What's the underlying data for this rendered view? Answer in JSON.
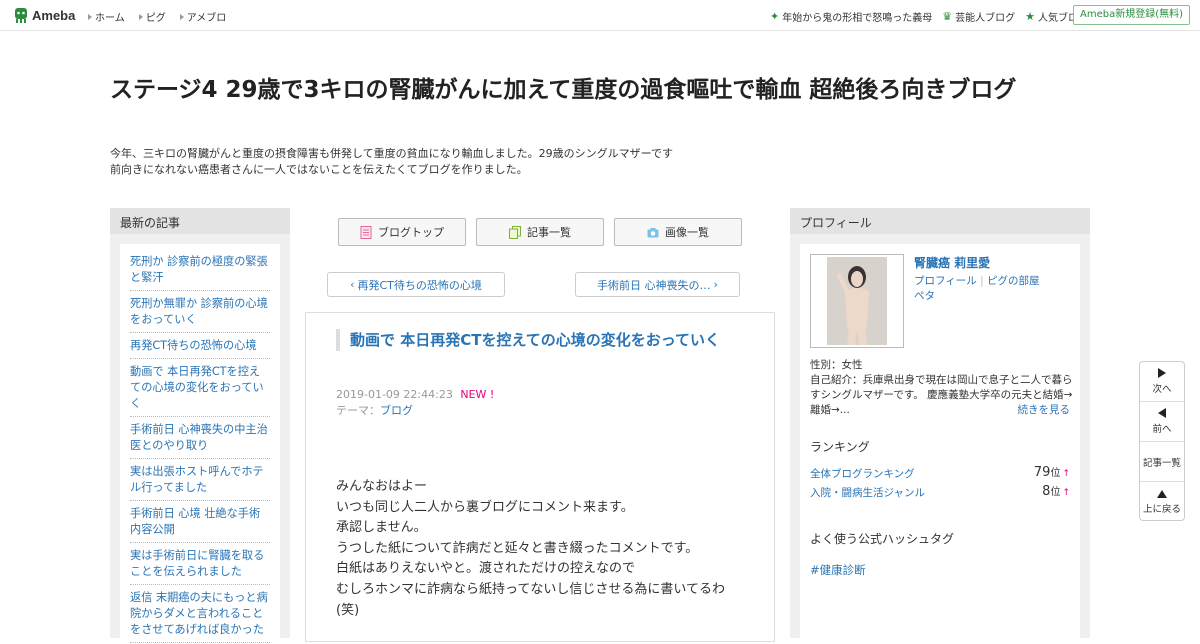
{
  "topbar": {
    "logo_text": "Ameba",
    "nav": [
      "ホーム",
      "ピグ",
      "アメブロ"
    ],
    "right_links": [
      {
        "label": "年始から鬼の形相で怒鳴った義母",
        "icon": "sparkle-icon"
      },
      {
        "label": "芸能人ブログ",
        "icon": "crown-icon"
      },
      {
        "label": "人気ブログ",
        "icon": "star-icon"
      }
    ],
    "register_label": "Ameba新規登録(無料)"
  },
  "header": {
    "title": "ステージ4 29歳で3キロの腎臓がんに加えて重度の過食嘔吐で輸血 超絶後ろ向きブログ",
    "description_lines": [
      "今年、三キロの腎臓がんと重度の摂食障害も併発して重度の貧血になり輸血しました。29歳のシングルマザーです",
      "前向きになれない癌患者さんに一人ではないことを伝えたくてブログを作りました。"
    ]
  },
  "left": {
    "heading": "最新の記事",
    "entries": [
      "死刑か 診察前の極度の緊張と緊汗",
      "死刑か無罪か 診察前の心境をおっていく",
      "再発CT待ちの恐怖の心境",
      "動画で 本日再発CTを控えての心境の変化をおっていく",
      "手術前日 心神喪失の中主治医とのやり取り",
      "実は出張ホスト呼んでホテル行ってました",
      "手術前日 心境 壮絶な手術内容公開",
      "実は手術前日に腎臓を取ることを伝えられました",
      "返信 末期癌の夫にもっと病院からダメと言われることをさせてあげれば良かった"
    ]
  },
  "center": {
    "buttons": [
      {
        "label": "ブログトップ",
        "icon": "document-icon"
      },
      {
        "label": "記事一覧",
        "icon": "copy-icon"
      },
      {
        "label": "画像一覧",
        "icon": "camera-icon"
      }
    ],
    "prev_label": "再発CT待ちの恐怖の心境",
    "next_label": "手術前日 心神喪失の…",
    "article": {
      "title": "動画で 本日再発CTを控えての心境の変化をおっていく",
      "date": "2019-01-09 22:44:23",
      "new_badge": "NEW !",
      "theme_prefix": "テーマ：",
      "theme": "ブログ",
      "body_lines": [
        "みんなおはよー",
        "いつも同じ人二人から裏ブログにコメント来ます。",
        "承認しません。",
        "うつした紙について詐病だと延々と書き綴ったコメントです。",
        "白紙はありえないやと。渡されただけの控えなので",
        "むしろホンマに詐病なら紙持ってないし信じさせる為に書いてるわ(笑)"
      ]
    }
  },
  "right": {
    "heading": "プロフィール",
    "name": "腎臓癌 莉里愛",
    "links": [
      "プロフィール",
      "ピグの部屋",
      "ペタ"
    ],
    "gender": "性別：女性",
    "intro": "自己紹介：兵庫県出身で現在は岡山で息子と二人で暮らすシングルマザーです。 慶應義塾大学卒の元夫と結婚→離婚→...",
    "more_label": "続きを見る",
    "ranking_heading": "ランキング",
    "rankings": [
      {
        "label": "全体ブログランキング",
        "value": "79",
        "unit": "位",
        "trend": "↑"
      },
      {
        "label": "入院・闘病生活ジャンル",
        "value": "8",
        "unit": "位",
        "trend": "↑"
      }
    ],
    "hashtag_heading": "よく使う公式ハッシュタグ",
    "hashtag": "#健康診断"
  },
  "floatnav": {
    "next": "次へ",
    "prev": "前へ",
    "list": "記事一覧",
    "top": "上に戻る"
  },
  "colors": {
    "link": "#2a74b6",
    "ameba_green": "#2d8c3c",
    "new_badge": "#e3007f"
  }
}
